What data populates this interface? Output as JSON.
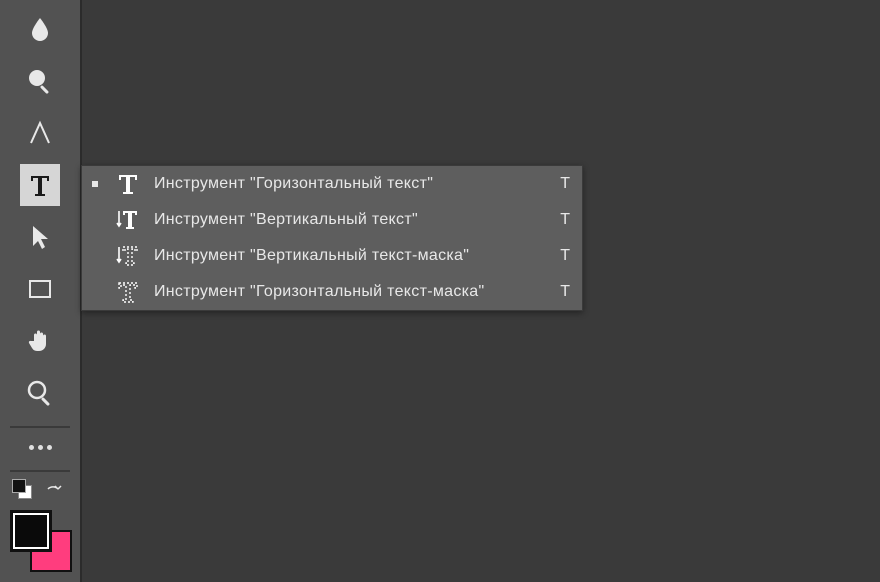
{
  "tools": [
    {
      "name": "blur-tool",
      "selected": false
    },
    {
      "name": "dodge-tool",
      "selected": false
    },
    {
      "name": "pen-tool",
      "selected": false
    },
    {
      "name": "type-tool",
      "selected": true
    },
    {
      "name": "path-selection-tool",
      "selected": false
    },
    {
      "name": "rectangle-tool",
      "selected": false
    },
    {
      "name": "hand-tool",
      "selected": false
    },
    {
      "name": "zoom-tool",
      "selected": false
    }
  ],
  "more_label": "more-options",
  "swatches": {
    "front": "#0a0a0a",
    "back": "#ff3d7e"
  },
  "flyout": {
    "items": [
      {
        "icon": "horizontal-type-icon",
        "label": "Инструмент \"Горизонтальный текст\"",
        "shortcut": "T",
        "selected": true
      },
      {
        "icon": "vertical-type-icon",
        "label": "Инструмент \"Вертикальный текст\"",
        "shortcut": "T",
        "selected": false
      },
      {
        "icon": "vertical-type-mask-icon",
        "label": "Инструмент \"Вертикальный текст-маска\"",
        "shortcut": "T",
        "selected": false
      },
      {
        "icon": "horizontal-type-mask-icon",
        "label": "Инструмент \"Горизонтальный текст-маска\"",
        "shortcut": "T",
        "selected": false
      }
    ]
  }
}
